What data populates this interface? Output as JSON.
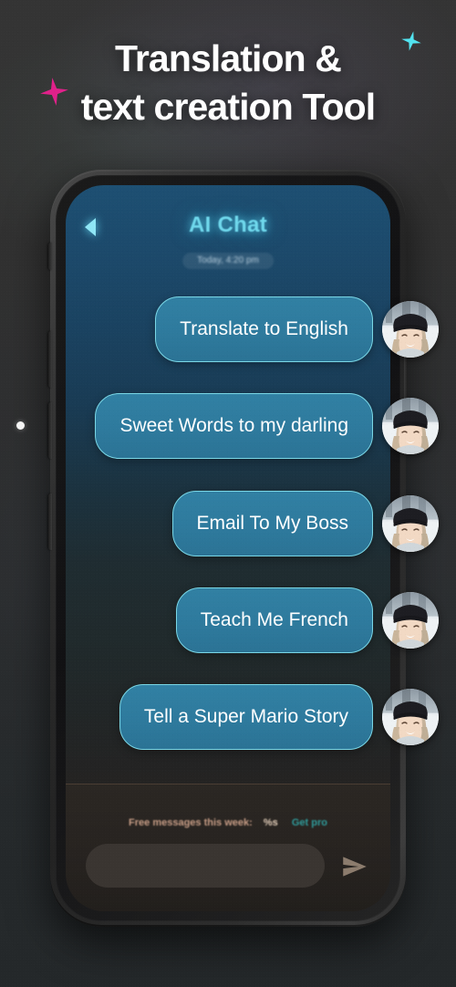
{
  "promo": {
    "headline_line1": "Translation &",
    "headline_line2": "text creation Tool",
    "sparkle_pink_color": "#e0218a",
    "sparkle_cyan_color": "#52e3f0"
  },
  "app": {
    "header": {
      "back_icon": "back-arrow-icon",
      "title": "AI Chat",
      "timestamp": "Today, 4:20 pm",
      "title_color": "#6fd8ec"
    },
    "messages": [
      {
        "text": "Translate to English",
        "avatar": "woman-in-black-beanie-avatar"
      },
      {
        "text": "Sweet Words to my darling",
        "avatar": "woman-in-black-beanie-avatar"
      },
      {
        "text": "Email To My Boss",
        "avatar": "woman-in-black-beanie-avatar"
      },
      {
        "text": "Teach Me French",
        "avatar": "woman-in-black-beanie-avatar"
      },
      {
        "text": "Tell a Super Mario Story",
        "avatar": "woman-in-black-beanie-avatar"
      }
    ],
    "bubble_color": "#2e7a9d",
    "bubble_border_color": "#7ad7e6",
    "footer": {
      "free_messages_label": "Free messages this week:",
      "free_messages_count": "%s",
      "get_pro_label": "Get pro",
      "get_pro_color": "#2f9c9c",
      "composer_placeholder": "",
      "composer_value": "",
      "send_icon": "send-paper-plane-icon"
    }
  }
}
